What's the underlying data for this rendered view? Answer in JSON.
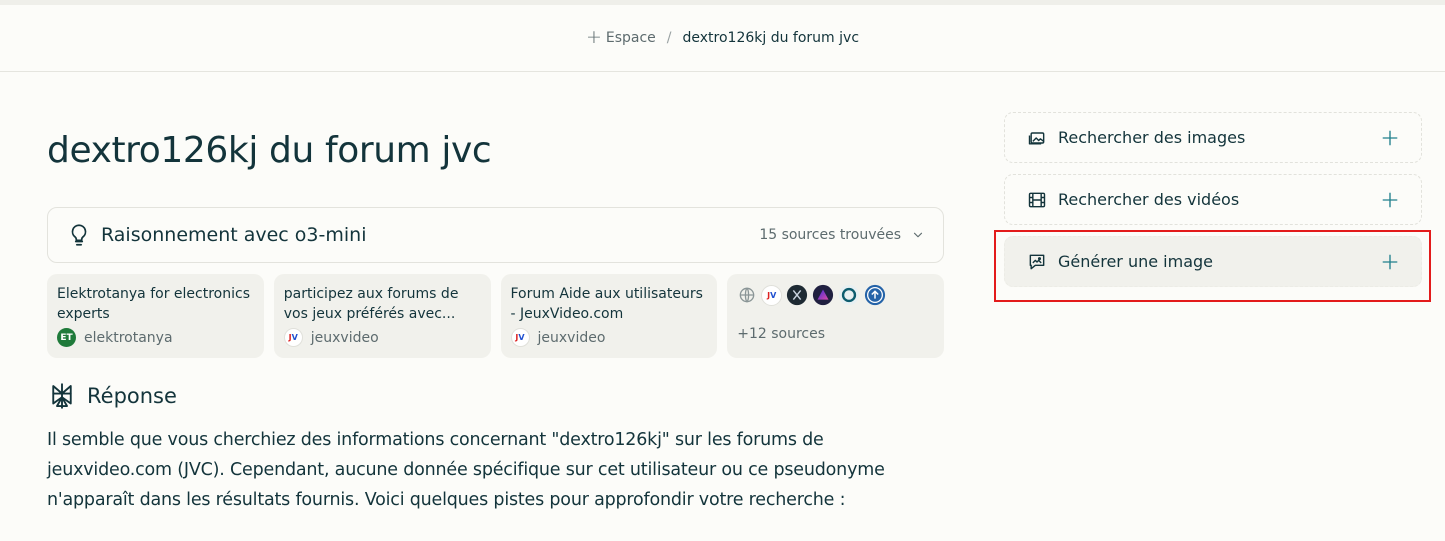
{
  "breadcrumb": {
    "space_label": "Espace",
    "separator": "/",
    "current": "dextro126kj du forum jvc"
  },
  "page_title": "dextro126kj du forum jvc",
  "reasoning": {
    "label": "Raisonnement avec o3-mini",
    "sources_found": "15 sources trouvées"
  },
  "source_cards": [
    {
      "title": "Elektrotanya for electronics experts",
      "source": "elektrotanya",
      "favicon_text": "ET"
    },
    {
      "title": "participez aux forums de vos jeux préférés avec...",
      "source": "jeuxvideo",
      "favicon_text": "JV"
    },
    {
      "title": "Forum Aide aux utilisateurs - JeuxVideo.com",
      "source": "jeuxvideo",
      "favicon_text": "JV"
    }
  ],
  "more_sources": {
    "label": "+12 sources",
    "icons": [
      "globe-icon",
      "jeuxvideo-favicon",
      "dark-x-favicon",
      "purple-gradient-favicon",
      "ring-favicon",
      "arrow-up-circle-favicon"
    ]
  },
  "answer": {
    "title": "Réponse",
    "text": "Il semble que vous cherchiez des informations concernant \"dextro126kj\" sur les forums de jeuxvideo.com (JVC). Cependant, aucune donnée spécifique sur cet utilisateur ou ce pseudonyme n'apparaît dans les résultats fournis. Voici quelques pistes pour approfondir votre recherche :"
  },
  "sidebar": {
    "search_images": "Rechercher des images",
    "search_videos": "Rechercher des vidéos",
    "generate_image": "Générer une image"
  },
  "colors": {
    "background": "#fcfcf9",
    "card": "#f1f1ec",
    "text": "#13343b",
    "muted": "#5d6b6e",
    "accent": "#20808d",
    "highlight": "#e31b1b"
  }
}
